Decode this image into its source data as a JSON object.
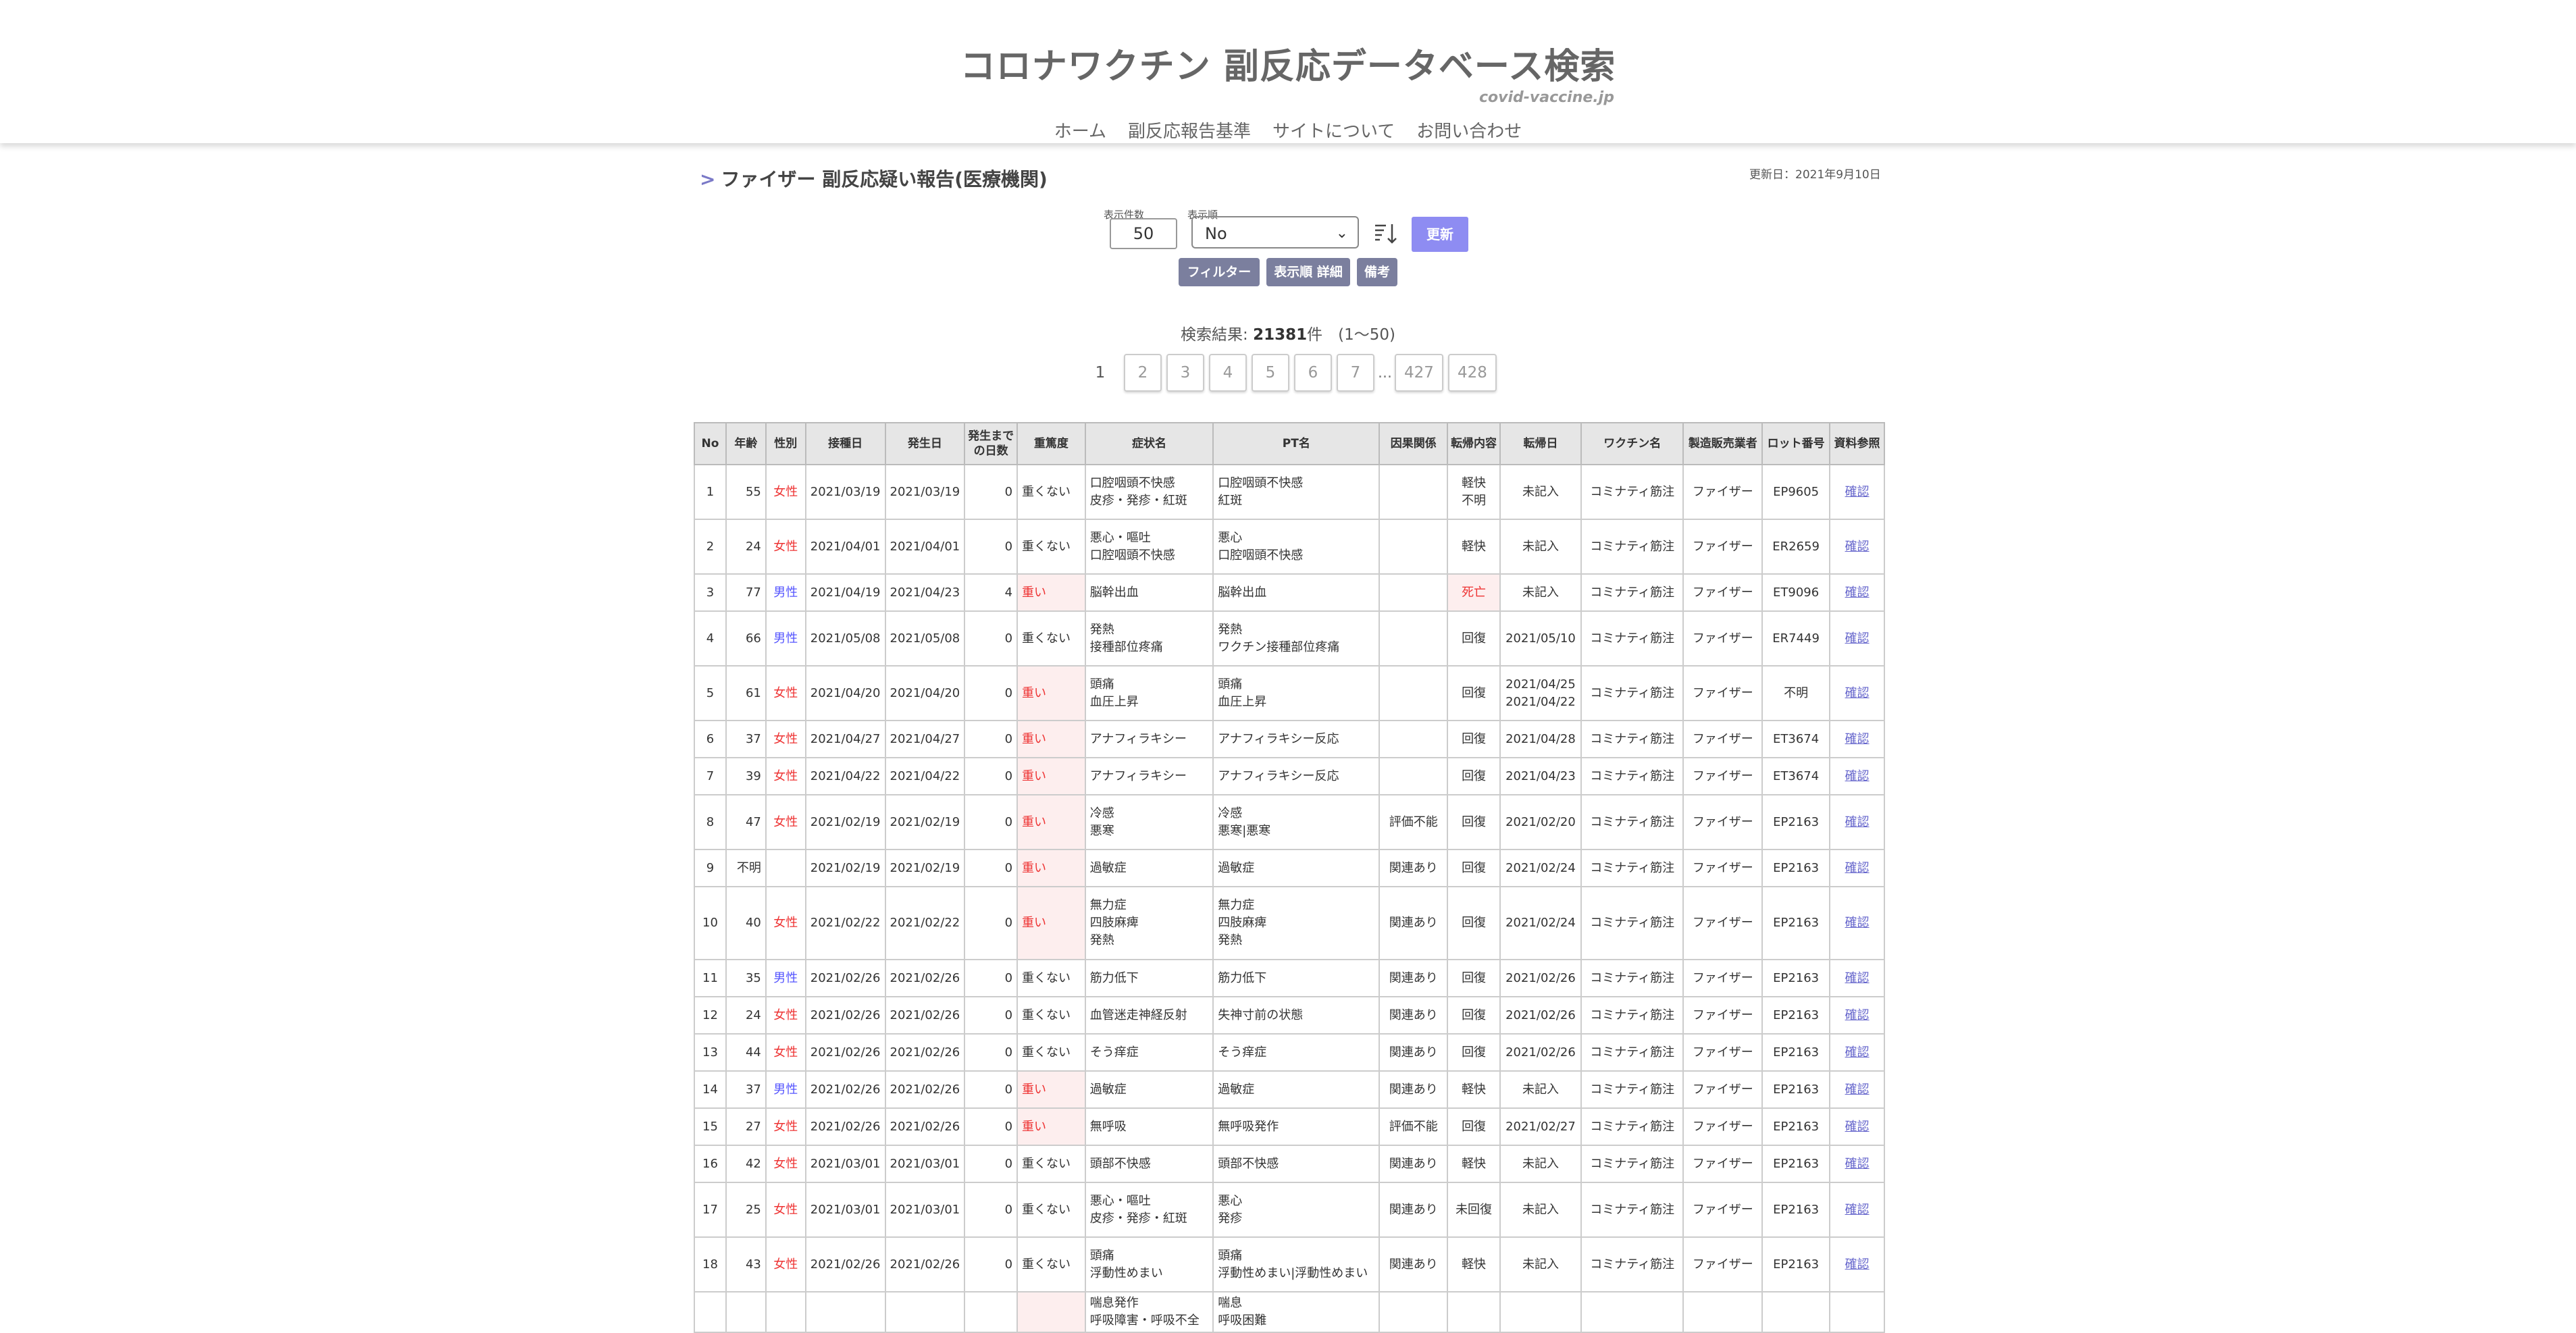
{
  "header": {
    "title": "コロナワクチン 副反応データベース検索",
    "domain": "covid-vaccine.jp",
    "nav": [
      "ホーム",
      "副反応報告基準",
      "サイトについて",
      "お問い合わせ"
    ]
  },
  "page": {
    "arrow": ">",
    "title": "ファイザー 副反応疑い報告(医療機関)",
    "updated": "更新日：2021年9月10日"
  },
  "controls": {
    "count_label": "表示件数",
    "count_value": "50",
    "sort_label": "表示順",
    "sort_value": "No",
    "update_button": "更新",
    "filter_button": "フィルター",
    "sort_detail_button": "表示順 詳細",
    "note_button": "備考"
  },
  "results": {
    "prefix": "検索結果:",
    "count": "21381",
    "suffix": "件　(1〜50)"
  },
  "pager": {
    "current": "1",
    "pages": [
      "2",
      "3",
      "4",
      "5",
      "6",
      "7"
    ],
    "dots": "...",
    "last_pages": [
      "427",
      "428"
    ]
  },
  "table": {
    "headers": [
      "No",
      "年齢",
      "性別",
      "接種日",
      "発生日",
      "発生まで\nの日数",
      "重篤度",
      "症状名",
      "PT名",
      "因果関係",
      "転帰内容",
      "転帰日",
      "ワクチン名",
      "製造販売業者",
      "ロット番号",
      "資料参照"
    ],
    "rows": [
      {
        "no": "1",
        "age": "55",
        "sex": "女性",
        "vax_date": "2021/03/19",
        "onset_date": "2021/03/19",
        "days": "0",
        "severity": "重くない",
        "symptoms": [
          "口腔咽頭不快感",
          "皮疹・発疹・紅斑"
        ],
        "pt": [
          "口腔咽頭不快感",
          "紅斑"
        ],
        "causality": "",
        "outcome": [
          "軽快",
          "不明"
        ],
        "outcome_date": [
          "未記入"
        ],
        "vaccine": "コミナティ筋注",
        "maker": "ファイザー",
        "lot": "EP9605",
        "ref": "確認"
      },
      {
        "no": "2",
        "age": "24",
        "sex": "女性",
        "vax_date": "2021/04/01",
        "onset_date": "2021/04/01",
        "days": "0",
        "severity": "重くない",
        "symptoms": [
          "悪心・嘔吐",
          "口腔咽頭不快感"
        ],
        "pt": [
          "悪心",
          "口腔咽頭不快感"
        ],
        "causality": "",
        "outcome": [
          "軽快"
        ],
        "outcome_date": [
          "未記入"
        ],
        "vaccine": "コミナティ筋注",
        "maker": "ファイザー",
        "lot": "ER2659",
        "ref": "確認"
      },
      {
        "no": "3",
        "age": "77",
        "sex": "男性",
        "vax_date": "2021/04/19",
        "onset_date": "2021/04/23",
        "days": "4",
        "severity": "重い",
        "symptoms": [
          "脳幹出血"
        ],
        "pt": [
          "脳幹出血"
        ],
        "causality": "",
        "outcome": [
          "死亡"
        ],
        "outcome_date": [
          "未記入"
        ],
        "vaccine": "コミナティ筋注",
        "maker": "ファイザー",
        "lot": "ET9096",
        "ref": "確認"
      },
      {
        "no": "4",
        "age": "66",
        "sex": "男性",
        "vax_date": "2021/05/08",
        "onset_date": "2021/05/08",
        "days": "0",
        "severity": "重くない",
        "symptoms": [
          "発熱",
          "接種部位疼痛"
        ],
        "pt": [
          "発熱",
          "ワクチン接種部位疼痛"
        ],
        "causality": "",
        "outcome": [
          "回復"
        ],
        "outcome_date": [
          "2021/05/10"
        ],
        "vaccine": "コミナティ筋注",
        "maker": "ファイザー",
        "lot": "ER7449",
        "ref": "確認"
      },
      {
        "no": "5",
        "age": "61",
        "sex": "女性",
        "vax_date": "2021/04/20",
        "onset_date": "2021/04/20",
        "days": "0",
        "severity": "重い",
        "symptoms": [
          "頭痛",
          "血圧上昇"
        ],
        "pt": [
          "頭痛",
          "血圧上昇"
        ],
        "causality": "",
        "outcome": [
          "回復"
        ],
        "outcome_date": [
          "2021/04/25",
          "2021/04/22"
        ],
        "vaccine": "コミナティ筋注",
        "maker": "ファイザー",
        "lot": "不明",
        "ref": "確認"
      },
      {
        "no": "6",
        "age": "37",
        "sex": "女性",
        "vax_date": "2021/04/27",
        "onset_date": "2021/04/27",
        "days": "0",
        "severity": "重い",
        "symptoms": [
          "アナフィラキシー"
        ],
        "pt": [
          "アナフィラキシー反応"
        ],
        "causality": "",
        "outcome": [
          "回復"
        ],
        "outcome_date": [
          "2021/04/28"
        ],
        "vaccine": "コミナティ筋注",
        "maker": "ファイザー",
        "lot": "ET3674",
        "ref": "確認"
      },
      {
        "no": "7",
        "age": "39",
        "sex": "女性",
        "vax_date": "2021/04/22",
        "onset_date": "2021/04/22",
        "days": "0",
        "severity": "重い",
        "symptoms": [
          "アナフィラキシー"
        ],
        "pt": [
          "アナフィラキシー反応"
        ],
        "causality": "",
        "outcome": [
          "回復"
        ],
        "outcome_date": [
          "2021/04/23"
        ],
        "vaccine": "コミナティ筋注",
        "maker": "ファイザー",
        "lot": "ET3674",
        "ref": "確認"
      },
      {
        "no": "8",
        "age": "47",
        "sex": "女性",
        "vax_date": "2021/02/19",
        "onset_date": "2021/02/19",
        "days": "0",
        "severity": "重い",
        "symptoms": [
          "冷感",
          "悪寒"
        ],
        "pt": [
          "冷感",
          "悪寒|悪寒"
        ],
        "causality": "評価不能",
        "outcome": [
          "回復"
        ],
        "outcome_date": [
          "2021/02/20"
        ],
        "vaccine": "コミナティ筋注",
        "maker": "ファイザー",
        "lot": "EP2163",
        "ref": "確認"
      },
      {
        "no": "9",
        "age": "不明",
        "sex": "",
        "vax_date": "2021/02/19",
        "onset_date": "2021/02/19",
        "days": "0",
        "severity": "重い",
        "symptoms": [
          "過敏症"
        ],
        "pt": [
          "過敏症"
        ],
        "causality": "関連あり",
        "outcome": [
          "回復"
        ],
        "outcome_date": [
          "2021/02/24"
        ],
        "vaccine": "コミナティ筋注",
        "maker": "ファイザー",
        "lot": "EP2163",
        "ref": "確認"
      },
      {
        "no": "10",
        "age": "40",
        "sex": "女性",
        "vax_date": "2021/02/22",
        "onset_date": "2021/02/22",
        "days": "0",
        "severity": "重い",
        "symptoms": [
          "無力症",
          "四肢麻痺",
          "発熱"
        ],
        "pt": [
          "無力症",
          "四肢麻痺",
          "発熱"
        ],
        "causality": "関連あり",
        "outcome": [
          "回復"
        ],
        "outcome_date": [
          "2021/02/24"
        ],
        "vaccine": "コミナティ筋注",
        "maker": "ファイザー",
        "lot": "EP2163",
        "ref": "確認"
      },
      {
        "no": "11",
        "age": "35",
        "sex": "男性",
        "vax_date": "2021/02/26",
        "onset_date": "2021/02/26",
        "days": "0",
        "severity": "重くない",
        "symptoms": [
          "筋力低下"
        ],
        "pt": [
          "筋力低下"
        ],
        "causality": "関連あり",
        "outcome": [
          "回復"
        ],
        "outcome_date": [
          "2021/02/26"
        ],
        "vaccine": "コミナティ筋注",
        "maker": "ファイザー",
        "lot": "EP2163",
        "ref": "確認"
      },
      {
        "no": "12",
        "age": "24",
        "sex": "女性",
        "vax_date": "2021/02/26",
        "onset_date": "2021/02/26",
        "days": "0",
        "severity": "重くない",
        "symptoms": [
          "血管迷走神経反射"
        ],
        "pt": [
          "失神寸前の状態"
        ],
        "causality": "関連あり",
        "outcome": [
          "回復"
        ],
        "outcome_date": [
          "2021/02/26"
        ],
        "vaccine": "コミナティ筋注",
        "maker": "ファイザー",
        "lot": "EP2163",
        "ref": "確認"
      },
      {
        "no": "13",
        "age": "44",
        "sex": "女性",
        "vax_date": "2021/02/26",
        "onset_date": "2021/02/26",
        "days": "0",
        "severity": "重くない",
        "symptoms": [
          "そう痒症"
        ],
        "pt": [
          "そう痒症"
        ],
        "causality": "関連あり",
        "outcome": [
          "回復"
        ],
        "outcome_date": [
          "2021/02/26"
        ],
        "vaccine": "コミナティ筋注",
        "maker": "ファイザー",
        "lot": "EP2163",
        "ref": "確認"
      },
      {
        "no": "14",
        "age": "37",
        "sex": "男性",
        "vax_date": "2021/02/26",
        "onset_date": "2021/02/26",
        "days": "0",
        "severity": "重い",
        "symptoms": [
          "過敏症"
        ],
        "pt": [
          "過敏症"
        ],
        "causality": "関連あり",
        "outcome": [
          "軽快"
        ],
        "outcome_date": [
          "未記入"
        ],
        "vaccine": "コミナティ筋注",
        "maker": "ファイザー",
        "lot": "EP2163",
        "ref": "確認"
      },
      {
        "no": "15",
        "age": "27",
        "sex": "女性",
        "vax_date": "2021/02/26",
        "onset_date": "2021/02/26",
        "days": "0",
        "severity": "重い",
        "symptoms": [
          "無呼吸"
        ],
        "pt": [
          "無呼吸発作"
        ],
        "causality": "評価不能",
        "outcome": [
          "回復"
        ],
        "outcome_date": [
          "2021/02/27"
        ],
        "vaccine": "コミナティ筋注",
        "maker": "ファイザー",
        "lot": "EP2163",
        "ref": "確認"
      },
      {
        "no": "16",
        "age": "42",
        "sex": "女性",
        "vax_date": "2021/03/01",
        "onset_date": "2021/03/01",
        "days": "0",
        "severity": "重くない",
        "symptoms": [
          "頭部不快感"
        ],
        "pt": [
          "頭部不快感"
        ],
        "causality": "関連あり",
        "outcome": [
          "軽快"
        ],
        "outcome_date": [
          "未記入"
        ],
        "vaccine": "コミナティ筋注",
        "maker": "ファイザー",
        "lot": "EP2163",
        "ref": "確認"
      },
      {
        "no": "17",
        "age": "25",
        "sex": "女性",
        "vax_date": "2021/03/01",
        "onset_date": "2021/03/01",
        "days": "0",
        "severity": "重くない",
        "symptoms": [
          "悪心・嘔吐",
          "皮疹・発疹・紅斑"
        ],
        "pt": [
          "悪心",
          "発疹"
        ],
        "causality": "関連あり",
        "outcome": [
          "未回復"
        ],
        "outcome_date": [
          "未記入"
        ],
        "vaccine": "コミナティ筋注",
        "maker": "ファイザー",
        "lot": "EP2163",
        "ref": "確認"
      },
      {
        "no": "18",
        "age": "43",
        "sex": "女性",
        "vax_date": "2021/02/26",
        "onset_date": "2021/02/26",
        "days": "0",
        "severity": "重くない",
        "symptoms": [
          "頭痛",
          "浮動性めまい"
        ],
        "pt": [
          "頭痛",
          "浮動性めまい|浮動性めまい"
        ],
        "causality": "関連あり",
        "outcome": [
          "軽快"
        ],
        "outcome_date": [
          "未記入"
        ],
        "vaccine": "コミナティ筋注",
        "maker": "ファイザー",
        "lot": "EP2163",
        "ref": "確認"
      },
      {
        "no": "",
        "age": "",
        "sex": "",
        "vax_date": "",
        "onset_date": "",
        "days": "",
        "severity": "",
        "symptoms": [
          "喘息発作",
          "呼吸障害・呼吸不全"
        ],
        "pt": [
          "喘息",
          "呼吸困難"
        ],
        "causality": "",
        "outcome": [
          ""
        ],
        "outcome_date": [
          ""
        ],
        "vaccine": "",
        "maker": "",
        "lot": "",
        "ref": ""
      }
    ]
  },
  "colors": {
    "female": "#ee3333",
    "male": "#5555ff",
    "severe_bg": "#fdeeee",
    "accent": "#8e8cf2",
    "button_gray": "#7b7f9e"
  }
}
